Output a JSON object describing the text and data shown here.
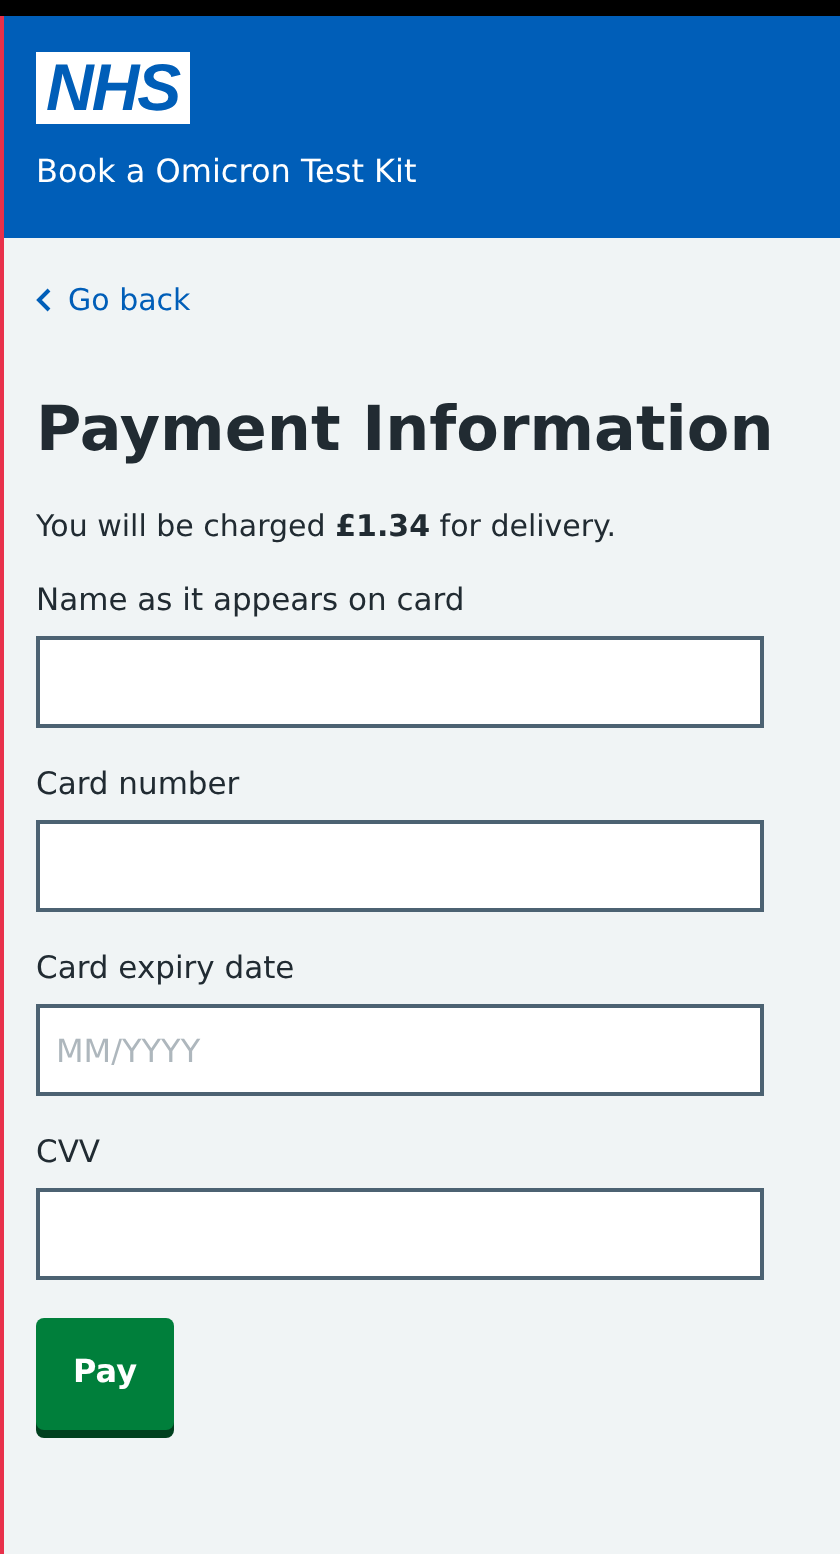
{
  "header": {
    "logo": "NHS",
    "service_name": "Book a Omicron Test Kit"
  },
  "back_link": "Go back",
  "heading": "Payment Information",
  "intro": "You will be charged **£1.34** for delivery.",
  "fields": [
    {
      "label": "Name as it appears on card"
    },
    {
      "label": "Card number"
    },
    {
      "label": "Card expiry date",
      "placeholder": "MM/YYYY"
    },
    {
      "label": "CVV"
    }
  ],
  "submit_button": "Pay"
}
